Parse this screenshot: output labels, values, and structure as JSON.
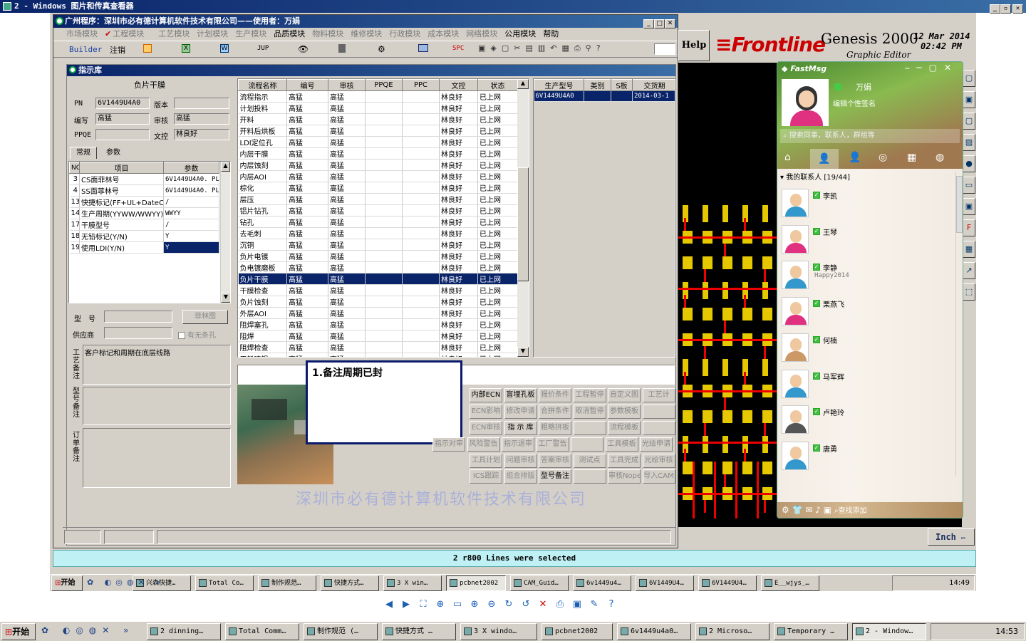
{
  "outer_window": {
    "title": "2 - Windows 图片和传真查看器",
    "icon": "image-viewer-icon"
  },
  "app": {
    "title": "广州程序：深圳市必有德计算机软件技术有限公司——使用者：万娟",
    "menu": [
      "市场模块",
      "工程模块",
      "工艺模块",
      "计划模块",
      "生产模块",
      "品质模块",
      "物料模块",
      "维修模块",
      "行政模块",
      "成本模块",
      "网络模块",
      "公用模块",
      "帮助"
    ],
    "toolbar": {
      "builder": "Builder",
      "logout": "注销",
      "jup": "JUP",
      "spc": "SPC"
    },
    "subwindow_title": "指示库",
    "left": {
      "header": "负片干膜",
      "pn_label": "PN",
      "pn_value": "6V1449U4A0",
      "version_label": "版本",
      "version_value": "",
      "author_label": "编写",
      "author_value": "高猛",
      "review_label": "审核",
      "review_value": "高猛",
      "ppqe_label": "PPQE",
      "ppqe_value": "",
      "doc_label": "文控",
      "doc_value": "林良好",
      "tabs": [
        "常规",
        "参数"
      ],
      "param_headers": [
        "NO",
        "项目",
        "参数"
      ],
      "params": [
        {
          "no": "3",
          "item": "CS面菲林号",
          "value": "6V1449U4A0. PL"
        },
        {
          "no": "4",
          "item": "SS面菲林号",
          "value": "6V1449U4A0. PL"
        },
        {
          "no": "13",
          "item": "快捷标记(FF+UL+DateC",
          "value": "/"
        },
        {
          "no": "14",
          "item": "生产周期(YYWW/WWYY)",
          "value": "WWYY"
        },
        {
          "no": "17",
          "item": "干膜型号",
          "value": "/"
        },
        {
          "no": "18",
          "item": "无铅标记(Y/N)",
          "value": "Y"
        },
        {
          "no": "19",
          "item": "使用LDI(Y/N)",
          "value": "Y"
        }
      ],
      "model_label": "型　号",
      "film_button": "菲林图",
      "supplier_label": "供应商",
      "film_checkbox": "有无条孔",
      "craft_note_label": "工艺备注",
      "craft_note": "客户标记和周期在底层线路",
      "model_note_label": "型号备注",
      "order_note_label": "订单备注"
    },
    "flow": {
      "headers": [
        "流程名称",
        "编号",
        "审核",
        "PPQE",
        "PPC",
        "文控",
        "状态"
      ],
      "rows": [
        [
          "流程指示",
          "高猛",
          "高猛",
          "",
          "",
          "林良好",
          "已上网"
        ],
        [
          "计划投料",
          "高猛",
          "高猛",
          "",
          "",
          "林良好",
          "已上网"
        ],
        [
          "开料",
          "高猛",
          "高猛",
          "",
          "",
          "林良好",
          "已上网"
        ],
        [
          "开料后烘板",
          "高猛",
          "高猛",
          "",
          "",
          "林良好",
          "已上网"
        ],
        [
          "LDI定位孔",
          "高猛",
          "高猛",
          "",
          "",
          "林良好",
          "已上网"
        ],
        [
          "内层干膜",
          "高猛",
          "高猛",
          "",
          "",
          "林良好",
          "已上网"
        ],
        [
          "内层蚀刻",
          "高猛",
          "高猛",
          "",
          "",
          "林良好",
          "已上网"
        ],
        [
          "内层AOI",
          "高猛",
          "高猛",
          "",
          "",
          "林良好",
          "已上网"
        ],
        [
          "棕化",
          "高猛",
          "高猛",
          "",
          "",
          "林良好",
          "已上网"
        ],
        [
          "层压",
          "高猛",
          "高猛",
          "",
          "",
          "林良好",
          "已上网"
        ],
        [
          "铝片钻孔",
          "高猛",
          "高猛",
          "",
          "",
          "林良好",
          "已上网"
        ],
        [
          "钻孔",
          "高猛",
          "高猛",
          "",
          "",
          "林良好",
          "已上网"
        ],
        [
          "去毛刺",
          "高猛",
          "高猛",
          "",
          "",
          "林良好",
          "已上网"
        ],
        [
          "沉铜",
          "高猛",
          "高猛",
          "",
          "",
          "林良好",
          "已上网"
        ],
        [
          "负片电镀",
          "高猛",
          "高猛",
          "",
          "",
          "林良好",
          "已上网"
        ],
        [
          "负电镀磨板",
          "高猛",
          "高猛",
          "",
          "",
          "林良好",
          "已上网"
        ],
        [
          "负片干膜",
          "高猛",
          "高猛",
          "",
          "",
          "林良好",
          "已上网"
        ],
        [
          "干膜检查",
          "高猛",
          "高猛",
          "",
          "",
          "林良好",
          "已上网"
        ],
        [
          "负片蚀刻",
          "高猛",
          "高猛",
          "",
          "",
          "林良好",
          "已上网"
        ],
        [
          "外层AOI",
          "高猛",
          "高猛",
          "",
          "",
          "林良好",
          "已上网"
        ],
        [
          "阻焊塞孔",
          "高猛",
          "高猛",
          "",
          "",
          "林良好",
          "已上网"
        ],
        [
          "阻焊",
          "高猛",
          "高猛",
          "",
          "",
          "林良好",
          "已上网"
        ],
        [
          "阻焊检查",
          "高猛",
          "高猛",
          "",
          "",
          "林良好",
          "已上网"
        ],
        [
          "无铅喷锡",
          "高猛",
          "高猛",
          "",
          "",
          "林良好",
          "已上网"
        ]
      ],
      "selected_index": 16
    },
    "right": {
      "headers": [
        "生产型号",
        "类别",
        "S板",
        "交货期"
      ],
      "rows": [
        [
          "6V1449U4A0",
          "",
          "",
          "2014-03-1"
        ]
      ]
    },
    "note_popup": "1.备注周期已封",
    "module_buttons": [
      [
        "内部ECN",
        "盲埋孔板",
        "报价条件",
        "工程暂停",
        "自定义图",
        "工艺计"
      ],
      [
        "ECN影响",
        "修改申请",
        "合拼条件",
        "取消暂停",
        "参数模板",
        ""
      ],
      [
        "ECN审核",
        "指 示 库",
        "粗略拼板",
        "",
        "流程模板",
        ""
      ],
      [
        "指示对审",
        "风险警告",
        "指示退审",
        "工厂警告",
        "",
        "工具模板",
        "光绘申请"
      ],
      [
        "工具计划",
        "问题审核",
        "答案审核",
        "测试点",
        "工具完成",
        "光绘审核"
      ],
      [
        "ICS跟踪",
        "组合排版",
        "型号备注",
        "",
        "审核Nope",
        "导入CAM"
      ]
    ],
    "company_watermark": "深圳市必有德计算机软件技术有限公司"
  },
  "genesis": {
    "help": "Help",
    "brand": "Frontline",
    "product": "Genesis 2000",
    "subtitle": "Graphic Editor",
    "date": "12 Mar 2014",
    "time": "02:42 PM",
    "status": "2 r800 Lines were selected",
    "unit": "Inch"
  },
  "fastmsg": {
    "title": "FastMsg",
    "username": "万娟",
    "signature": "编辑个性签名",
    "search_placeholder": "搜索同事，联系人，群组等",
    "group": "我的联系人 [19/44]",
    "contacts": [
      {
        "name": "李凯",
        "status": ""
      },
      {
        "name": "王琴",
        "status": ""
      },
      {
        "name": "李静",
        "status": "Happy2014"
      },
      {
        "name": "栗燕飞",
        "status": ""
      },
      {
        "name": "何楠",
        "status": ""
      },
      {
        "name": "马军辉",
        "status": ""
      },
      {
        "name": "卢艳玲",
        "status": ""
      },
      {
        "name": "唐勇",
        "status": ""
      }
    ],
    "find_add": "查找添加"
  },
  "inner_taskbar": {
    "start": "开始",
    "items": [
      "兴森快捷…",
      "Total Co…",
      "制作规范…",
      "快捷方式…",
      "3 X win…",
      "pcbnet2002",
      "CAM_Guid…",
      "6v1449u4…",
      "6V1449U4…",
      "6V1449U4…",
      "E__wjys_…"
    ],
    "clock": "14:49"
  },
  "viewer_toolbar": {
    "icons": [
      "prev-icon",
      "next-icon",
      "best-fit-icon",
      "actual-size-icon",
      "slideshow-icon",
      "zoom-in-icon",
      "zoom-out-icon",
      "rotate-cw-icon",
      "rotate-ccw-icon",
      "delete-icon",
      "print-icon",
      "save-icon",
      "edit-icon",
      "help-icon"
    ]
  },
  "outer_taskbar": {
    "start": "开始",
    "items": [
      "2 dinning…",
      "Total Comm…",
      "制作规范 (…",
      "快捷方式 …",
      "3 X windo…",
      "pcbnet2002",
      "6v1449u4a0…",
      "2 Microso…",
      "Temporary …",
      "2 - Window…"
    ],
    "clock": "14:53"
  }
}
